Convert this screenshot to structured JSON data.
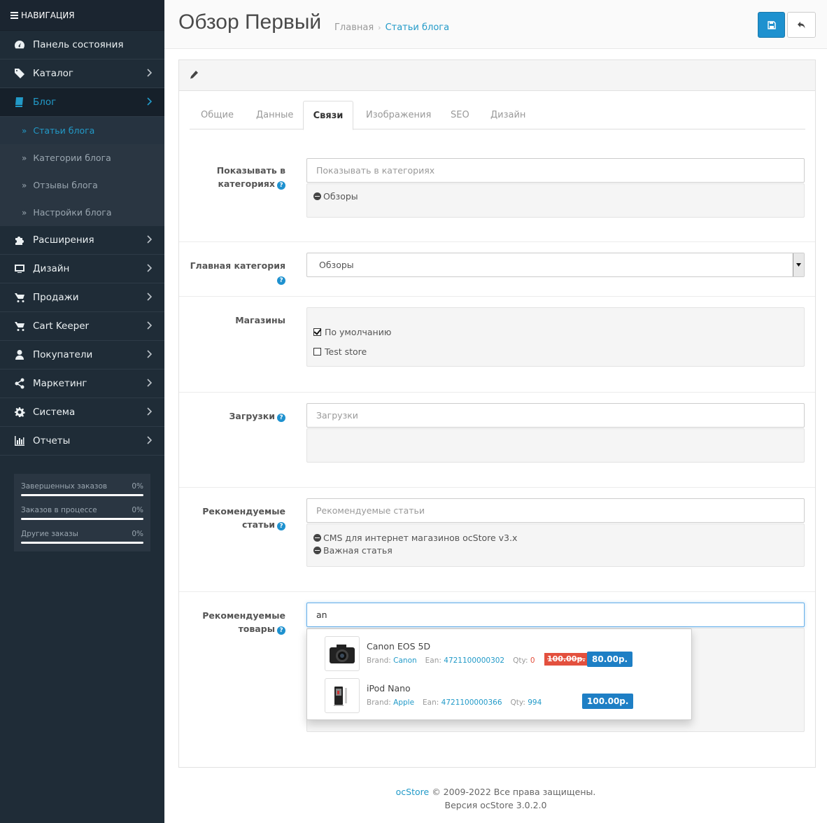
{
  "sidebar": {
    "header": "НАВИГАЦИЯ",
    "menu": [
      {
        "label": "Панель состояния",
        "icon": "dashboard-icon"
      },
      {
        "label": "Каталог",
        "icon": "tag-icon"
      },
      {
        "label": "Блог",
        "icon": "book-icon",
        "active": true
      },
      {
        "label": "Расширения",
        "icon": "puzzle-icon"
      },
      {
        "label": "Дизайн",
        "icon": "desktop-icon"
      },
      {
        "label": "Продажи",
        "icon": "cart-icon"
      },
      {
        "label": "Cart Keeper",
        "icon": "cart-arrow-icon"
      },
      {
        "label": "Покупатели",
        "icon": "user-icon"
      },
      {
        "label": "Маркетинг",
        "icon": "share-icon"
      },
      {
        "label": "Система",
        "icon": "cog-icon"
      },
      {
        "label": "Отчеты",
        "icon": "bar-chart-icon"
      }
    ],
    "blog_sub": [
      {
        "label": "Статьи блога",
        "active": true
      },
      {
        "label": "Категории блога"
      },
      {
        "label": "Отзывы блога"
      },
      {
        "label": "Настройки блога"
      }
    ],
    "stats": [
      {
        "label": "Завершенных заказов",
        "value": "0%"
      },
      {
        "label": "Заказов в процессе",
        "value": "0%"
      },
      {
        "label": "Другие заказы",
        "value": "0%"
      }
    ]
  },
  "header": {
    "title": "Обзор Первый",
    "breadcrumb": [
      "Главная",
      "Статьи блога"
    ]
  },
  "tabs": [
    "Общие",
    "Данные",
    "Связи",
    "Изображения",
    "SEO",
    "Дизайн"
  ],
  "active_tab": "Связи",
  "form": {
    "show_in_categories": {
      "label": "Показывать в категориях",
      "placeholder": "Показывать в категориях",
      "items": [
        "Обзоры"
      ]
    },
    "main_category": {
      "label": "Главная категория",
      "value": "Обзоры"
    },
    "stores": {
      "label": "Магазины",
      "options": [
        {
          "label": "По умолчанию",
          "checked": true
        },
        {
          "label": "Test store",
          "checked": false
        }
      ]
    },
    "downloads": {
      "label": "Загрузки",
      "placeholder": "Загрузки"
    },
    "related_articles": {
      "label": "Рекомендуемые статьи",
      "placeholder": "Рекомендуемые статьи",
      "items": [
        "CMS для интернет магазинов ocStore v3.x",
        "Важная статья"
      ]
    },
    "related_products": {
      "label": "Рекомендуемые товары",
      "value": "an"
    }
  },
  "autocomplete": [
    {
      "name": "Canon EOS 5D",
      "brand_label": "Brand:",
      "brand": "Canon",
      "ean_label": "Ean:",
      "ean": "4721100000302",
      "qty_label": "Qty:",
      "qty": "0",
      "old_price": "100.00р.",
      "price": "80.00р."
    },
    {
      "name": "iPod Nano",
      "brand_label": "Brand:",
      "brand": "Apple",
      "ean_label": "Ean:",
      "ean": "4721100000366",
      "qty_label": "Qty:",
      "qty": "994",
      "old_price": "",
      "price": "100.00р."
    }
  ],
  "footer": {
    "brand": "ocStore",
    "copyright": "© 2009-2022 Все права защищены.",
    "version": "Версия ocStore 3.0.2.0"
  },
  "colors": {
    "sidebar_bg": "#1f2c37",
    "accent": "#229ac8",
    "primary_button": "#1e91cf",
    "price_old": "#e3503e",
    "price_new": "#1e7fc5"
  }
}
